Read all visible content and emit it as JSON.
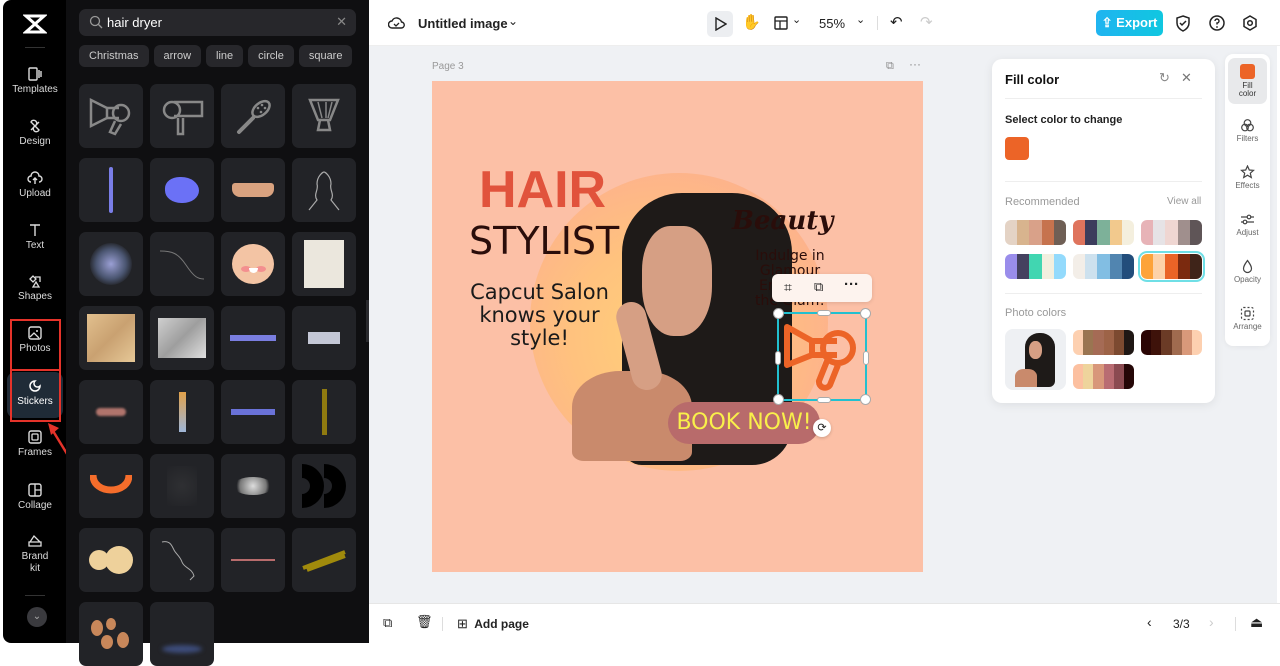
{
  "app": {
    "title": "Untitled image",
    "zoom": "55%",
    "export_label": "Export"
  },
  "rail": {
    "items": [
      {
        "label": "Templates",
        "icon": "templates-icon"
      },
      {
        "label": "Design",
        "icon": "design-icon"
      },
      {
        "label": "Upload",
        "icon": "upload-icon"
      },
      {
        "label": "Text",
        "icon": "text-icon"
      },
      {
        "label": "Shapes",
        "icon": "shapes-icon"
      },
      {
        "label": "Photos",
        "icon": "photos-icon"
      },
      {
        "label": "Stickers",
        "icon": "stickers-icon",
        "active": true
      },
      {
        "label": "Frames",
        "icon": "frames-icon"
      },
      {
        "label": "Collage",
        "icon": "collage-icon"
      },
      {
        "label": "Brand",
        "label2": "kit",
        "icon": "brand-kit-icon"
      }
    ]
  },
  "panel": {
    "search_value": "hair dryer",
    "chips": [
      "Christmas",
      "arrow",
      "line",
      "circle",
      "square"
    ],
    "stickers": [
      "hair dryer outline",
      "hair dryer side",
      "hair brush",
      "shaving brush",
      "blue stroke",
      "blue blob",
      "skin tone torn paper",
      "curly hair silhouette",
      "blurred glow",
      "curved line",
      "cartoon face",
      "paper texture",
      "foundation texture",
      "grey texture",
      "blue tape",
      "grey tape",
      "pink smudge",
      "gradient strip",
      "blue strip",
      "olive stroke",
      "orange arc",
      "faint scribble",
      "smoke cloud",
      "black arcs",
      "cream blob",
      "white squiggle",
      "pink line",
      "olive scribble",
      "almonds",
      "blue blur"
    ]
  },
  "canvas": {
    "page_label": "Page 3",
    "design": {
      "headline1": "HAIR",
      "headline2": "STYLIST",
      "tagline1": "Capcut Salon",
      "tagline2": "knows your",
      "tagline3": "style!",
      "beauty": "Beauty",
      "indulge1": "Indulge in",
      "indulge2": "Glamour",
      "indulge3": "Embrace",
      "indulge4": "the Glam!",
      "cta": "BOOK NOW!"
    }
  },
  "bottom": {
    "add_page": "Add page",
    "page_counter": "3/3"
  },
  "fill_panel": {
    "title": "Fill color",
    "select_label": "Select color to change",
    "current_color": "#ec6427",
    "recommended_label": "Recommended",
    "view_all": "View all",
    "recommended": [
      [
        "#e4d3c5",
        "#d8b48e",
        "#d9a189",
        "#c6734e",
        "#6f5f55"
      ],
      [
        "#df745d",
        "#3c3d5c",
        "#7db199",
        "#f2c98d",
        "#f4efde"
      ],
      [
        "#e7b3b7",
        "#e6e3e6",
        "#efd6d2",
        "#a08f8d",
        "#5f5557"
      ],
      [
        "#9a8deb",
        "#45415f",
        "#41d6b1",
        "#f2efdf",
        "#93dafc"
      ],
      [
        "#f3eee8",
        "#cde1ee",
        "#82bee3",
        "#5185b0",
        "#224d7b"
      ],
      [
        "#fda33a",
        "#fdd2a9",
        "#ea6427",
        "#7b2a0f",
        "#3f2419"
      ]
    ],
    "photo_colors_label": "Photo colors",
    "photo_colors": [
      [
        "#fdd0b0",
        "#9a7551",
        "#a56b55",
        "#9d6347",
        "#7c4a30",
        "#1f1714"
      ],
      [
        "#2a0504",
        "#3e120a",
        "#6b3b26",
        "#a06b4f",
        "#d9997a",
        "#fdd0b0"
      ],
      [
        "#fcc0a0",
        "#eed49c",
        "#d8977a",
        "#b96c72",
        "#8b4b51",
        "#250707"
      ]
    ]
  },
  "right_rail": {
    "items": [
      {
        "label": "Fill",
        "label2": "color"
      },
      {
        "label": "Filters"
      },
      {
        "label": "Effects"
      },
      {
        "label": "Adjust"
      },
      {
        "label": "Opacity"
      },
      {
        "label": "Arrange"
      }
    ]
  }
}
